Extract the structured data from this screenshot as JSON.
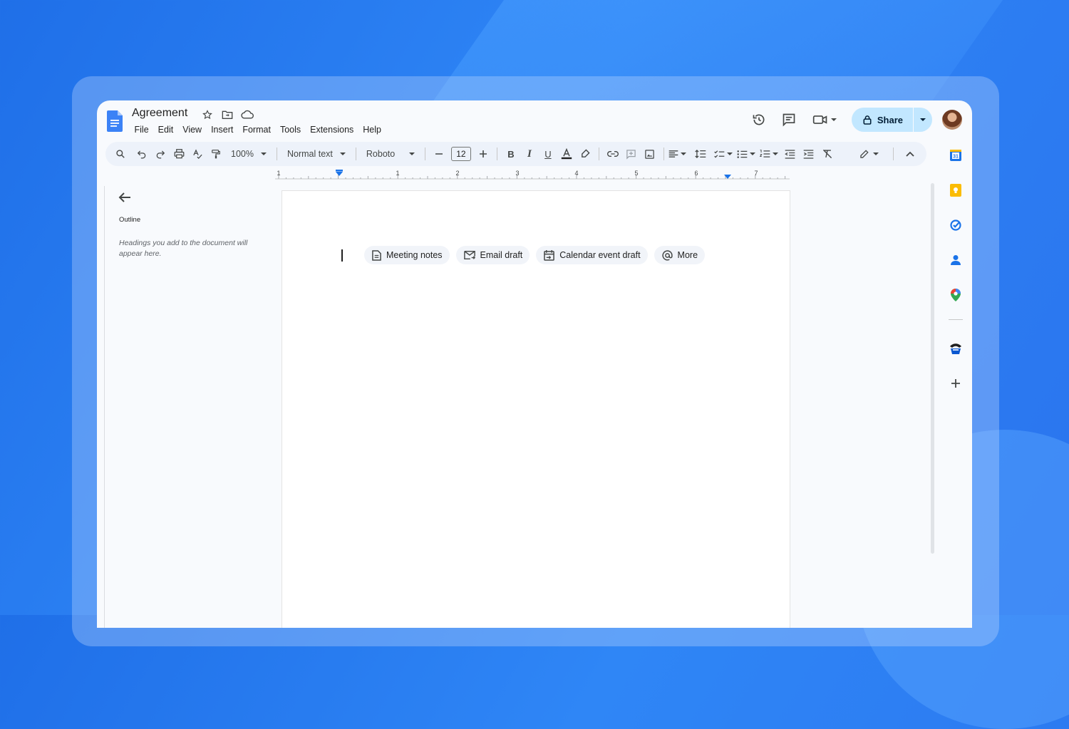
{
  "document": {
    "title": "Agreement"
  },
  "menu": [
    "File",
    "Edit",
    "View",
    "Insert",
    "Format",
    "Tools",
    "Extensions",
    "Help"
  ],
  "header": {
    "share_label": "Share"
  },
  "toolbar": {
    "zoom": "100%",
    "style": "Normal text",
    "font": "Roboto",
    "font_size": "12"
  },
  "ruler": {
    "labels": [
      "1",
      "1",
      "2",
      "3",
      "4",
      "5",
      "6",
      "7"
    ]
  },
  "outline": {
    "title": "Outline",
    "hint": "Headings you add to the document will appear here."
  },
  "chips": [
    {
      "label": "Meeting notes",
      "icon": "document-icon"
    },
    {
      "label": "Email draft",
      "icon": "email-icon"
    },
    {
      "label": "Calendar event draft",
      "icon": "calendar-icon"
    },
    {
      "label": "More",
      "icon": "at-sign-icon"
    }
  ],
  "side_panel": [
    "calendar-icon",
    "keep-icon",
    "tasks-icon",
    "contacts-icon",
    "maps-icon",
    "addon-icon",
    "add-icon"
  ],
  "colors": {
    "share_bg": "#c2e7ff",
    "toolbar_bg": "#edf2fa",
    "accent": "#1a73e8"
  }
}
